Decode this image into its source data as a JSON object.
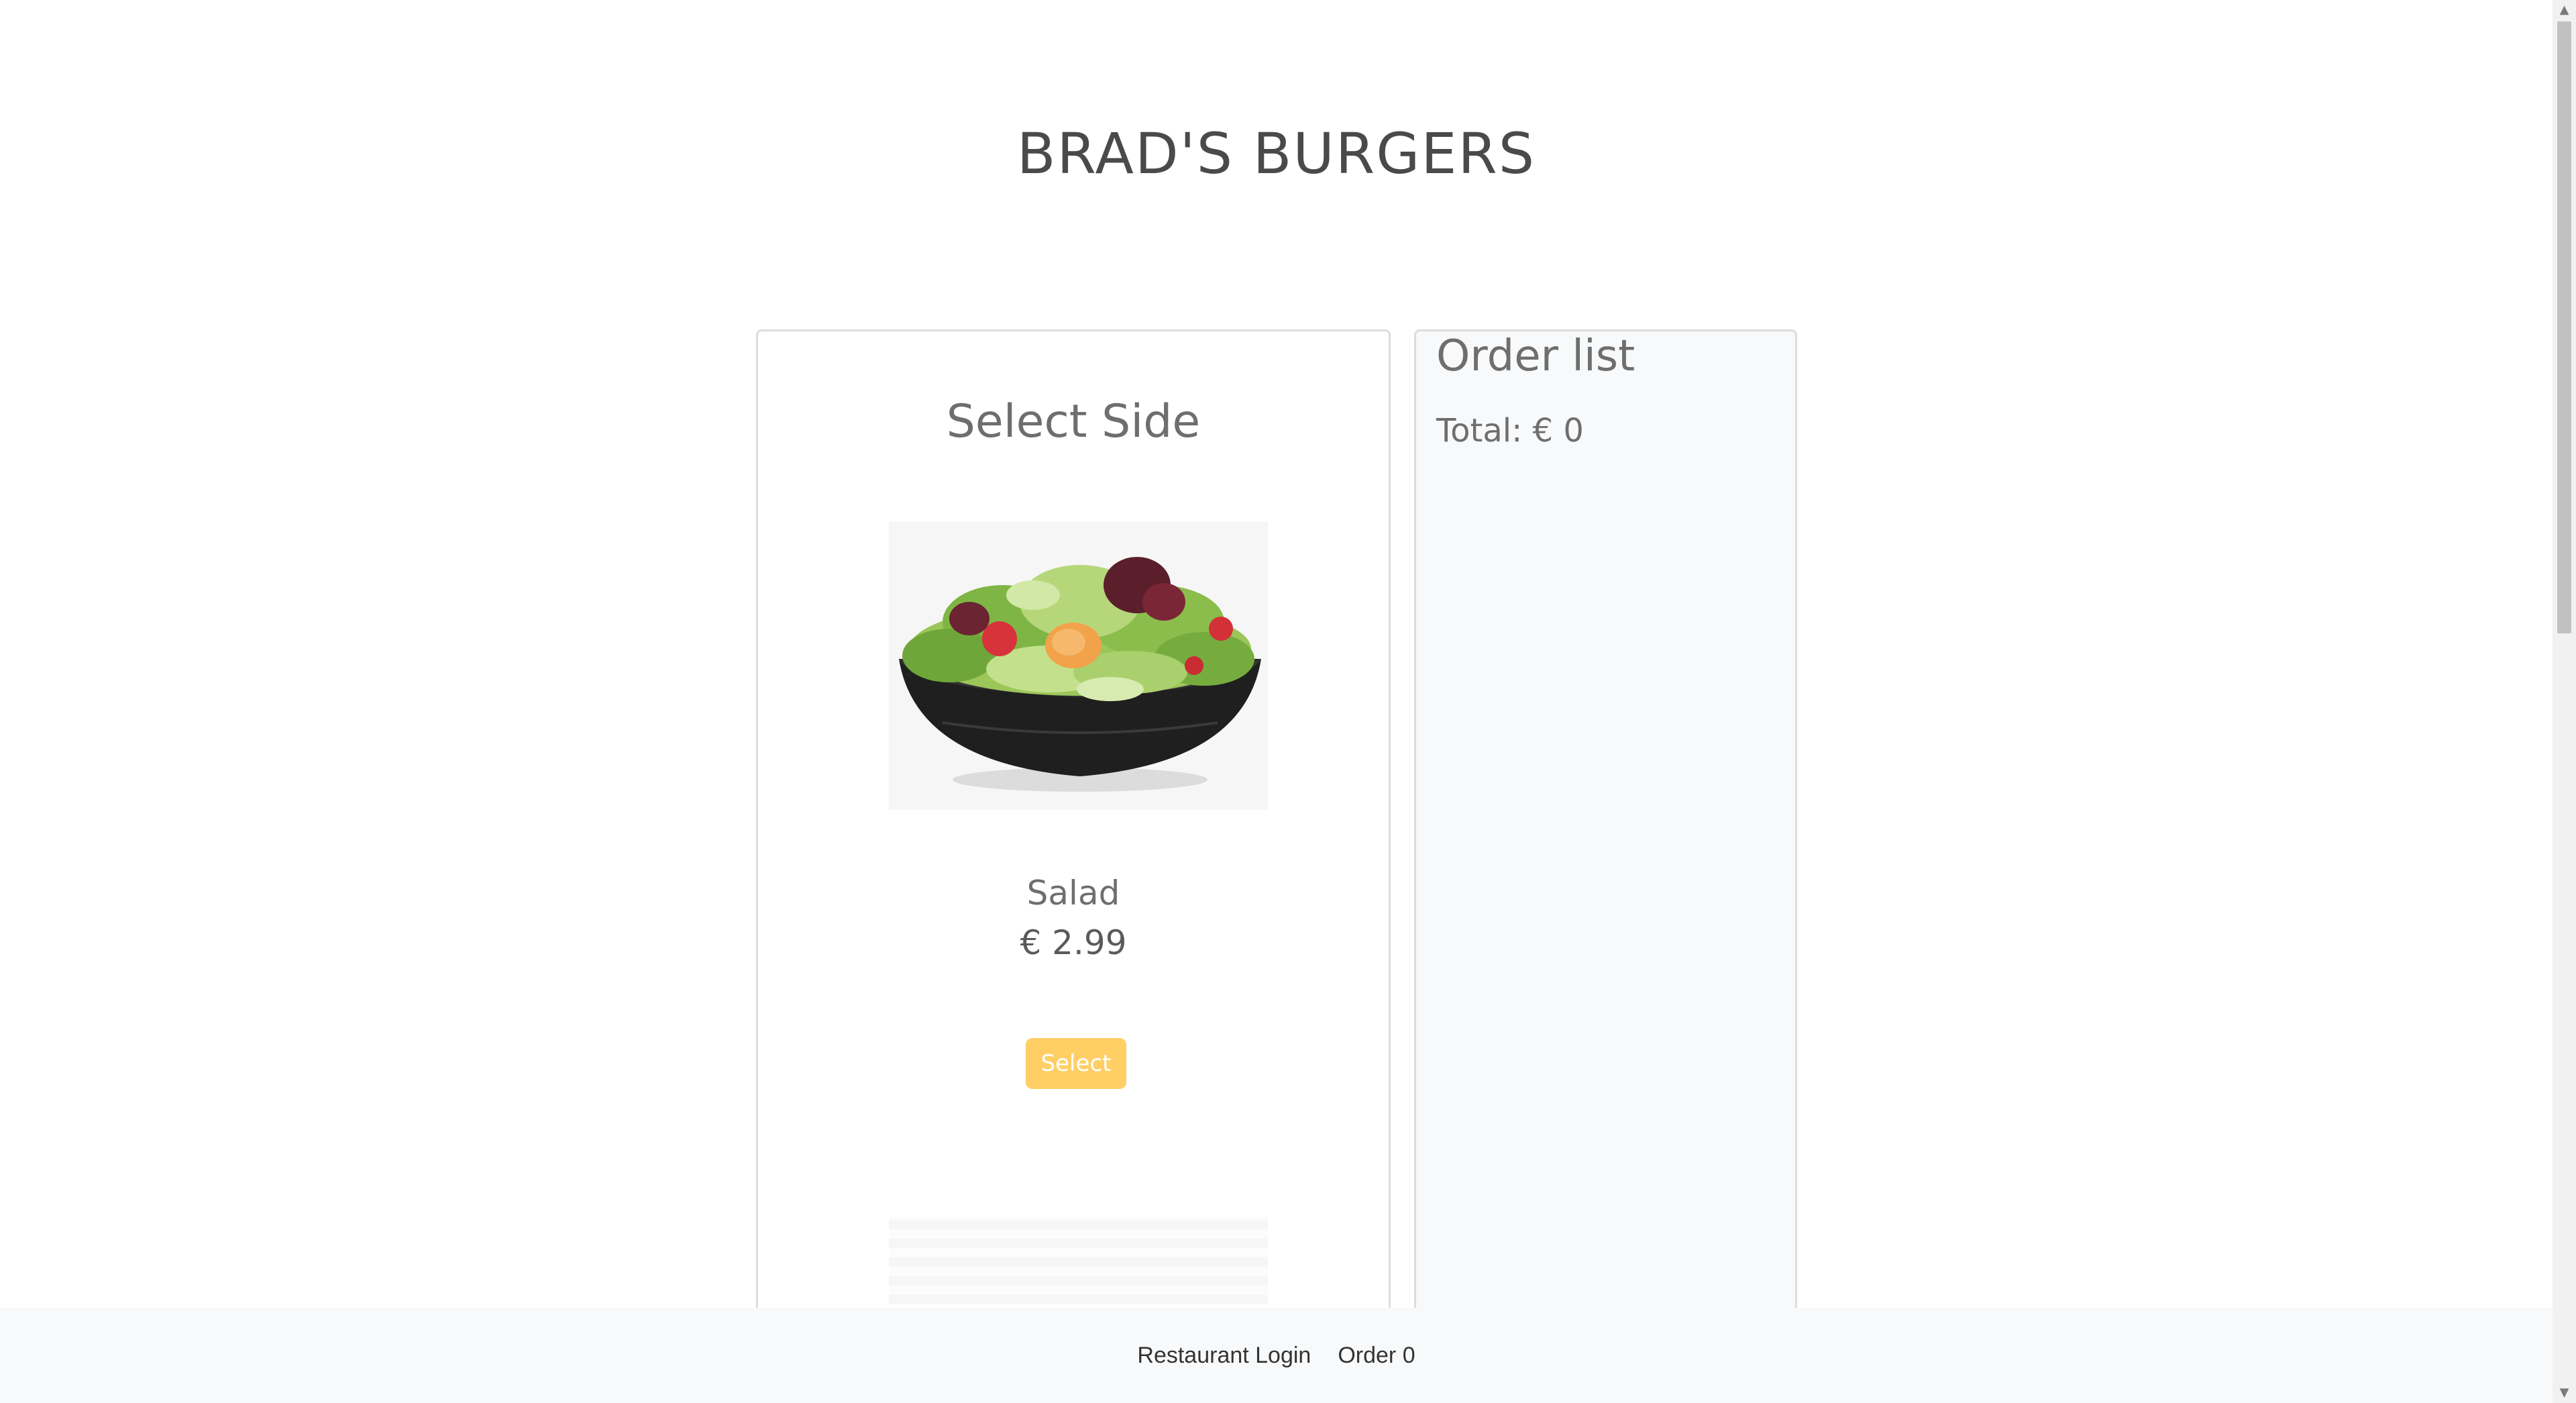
{
  "header": {
    "title": "BRAD'S BURGERS"
  },
  "side_selection": {
    "title": "Select Side",
    "product": {
      "name": "Salad",
      "price": "€ 2.99",
      "image_icon": "salad-bowl-image"
    },
    "select_label": "Select"
  },
  "order_list": {
    "title": "Order list",
    "total": "Total: € 0"
  },
  "footer": {
    "restaurant_login": "Restaurant Login",
    "order": "Order 0"
  },
  "colors": {
    "select_button": "#ffcf66",
    "panel_border": "#dcdcdc",
    "order_panel_bg": "#f8f9fa",
    "footer_bg": "#f8f9fa"
  }
}
